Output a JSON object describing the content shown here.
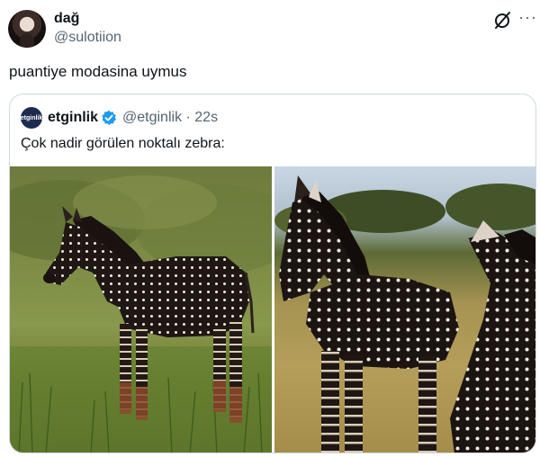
{
  "tweet": {
    "author": {
      "display_name": "dağ",
      "handle": "@sulotiion"
    },
    "text": "puantiye modasina uymus",
    "more_label": "···"
  },
  "quote": {
    "author": {
      "avatar_label": "etginlik",
      "display_name": "etginlik",
      "handle": "@etginlik",
      "time": "22s"
    },
    "text": "Çok nadir görülen noktalı zebra:"
  },
  "icons": {
    "grok": "grok-icon",
    "more": "more-icon",
    "verified": "verified-badge-icon"
  },
  "colors": {
    "text": "#0f1419",
    "secondary": "#536471",
    "border": "#cfd9de",
    "verified": "#1d9bf0"
  }
}
